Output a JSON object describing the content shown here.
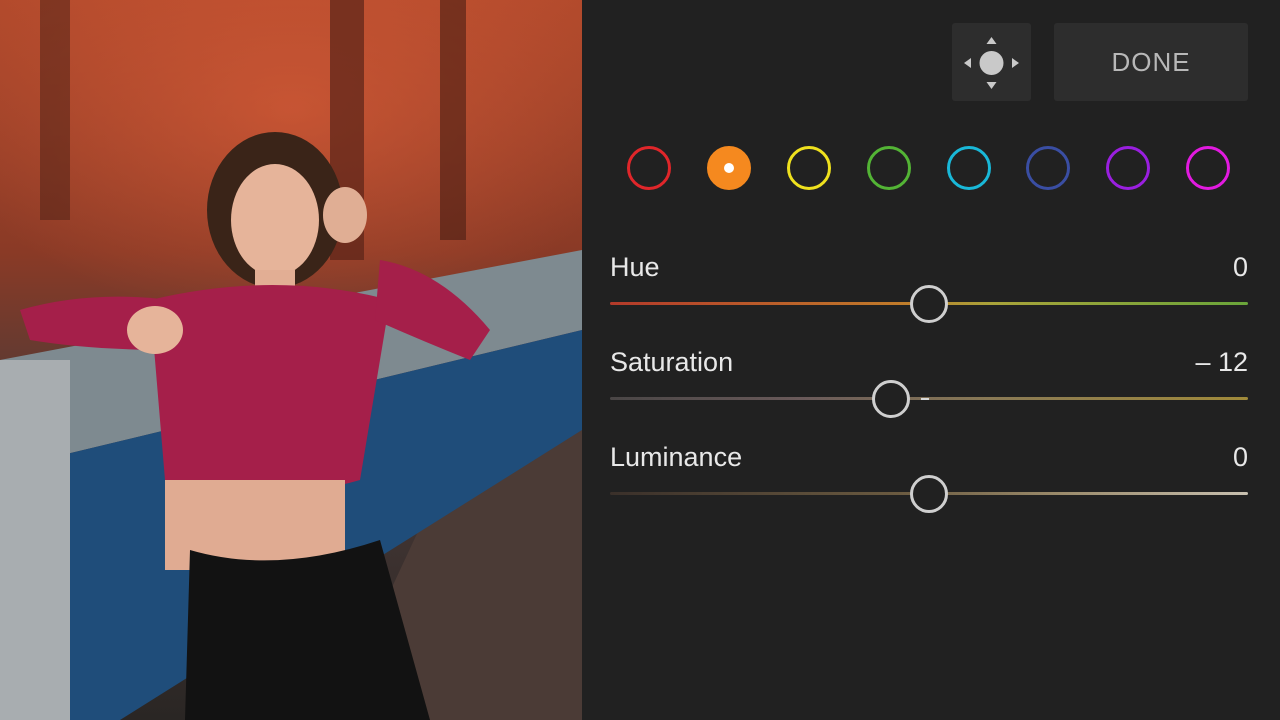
{
  "toolbar": {
    "move_icon": "target-move-icon",
    "done_label": "DONE"
  },
  "colors": [
    {
      "name": "red",
      "hex": "#e0262a",
      "selected": false
    },
    {
      "name": "orange",
      "hex": "#f5891f",
      "selected": true
    },
    {
      "name": "yellow",
      "hex": "#efe11e",
      "selected": false
    },
    {
      "name": "green",
      "hex": "#53b435",
      "selected": false
    },
    {
      "name": "aqua",
      "hex": "#19b8d8",
      "selected": false
    },
    {
      "name": "blue",
      "hex": "#3a4ea3",
      "selected": false
    },
    {
      "name": "purple",
      "hex": "#9a1fe0",
      "selected": false
    },
    {
      "name": "magenta",
      "hex": "#e21ae0",
      "selected": false
    }
  ],
  "sliders": {
    "hue": {
      "label": "Hue",
      "value_text": "0",
      "value": 0
    },
    "saturation": {
      "label": "Saturation",
      "value_text": "– 12",
      "value": -12
    },
    "luminance": {
      "label": "Luminance",
      "value_text": "0",
      "value": 0
    }
  }
}
